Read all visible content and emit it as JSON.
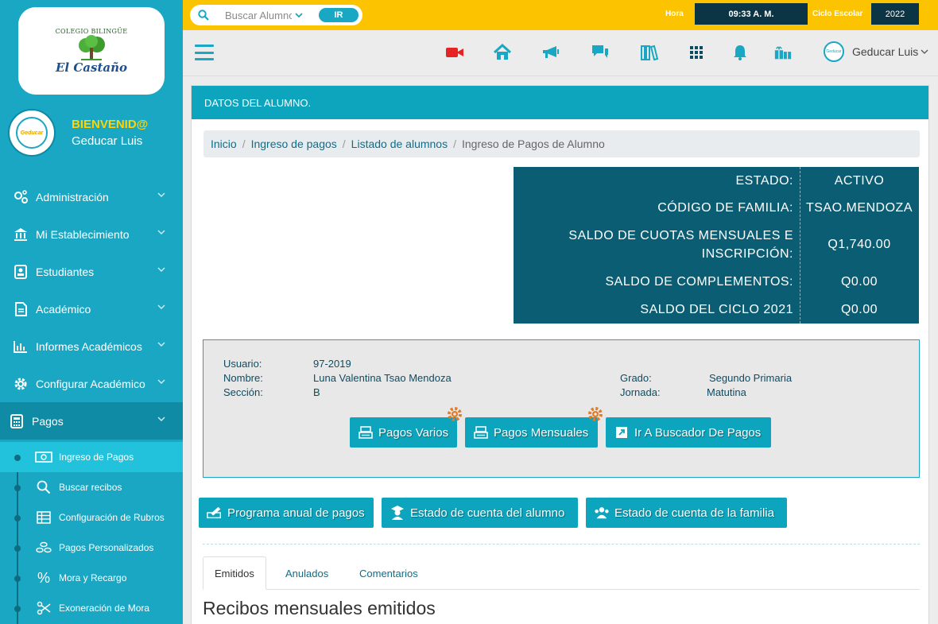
{
  "school": {
    "logo_arc": "COLEGIO BILINGÜE",
    "logo_name": "El Castaño",
    "avatar_text": "Geducar"
  },
  "welcome": {
    "greeting": "BIENVENID@",
    "user": "Geducar Luis"
  },
  "menu": [
    {
      "label": "Administración",
      "icon": "gears-icon"
    },
    {
      "label": "Mi Establecimiento",
      "icon": "bank-icon"
    },
    {
      "label": "Estudiantes",
      "icon": "student-card-icon"
    },
    {
      "label": "Académico",
      "icon": "document-icon"
    },
    {
      "label": "Informes Académicos",
      "icon": "bar-chart-icon"
    },
    {
      "label": "Configurar Académico",
      "icon": "gear-icon"
    },
    {
      "label": "Pagos",
      "icon": "calculator-icon"
    }
  ],
  "submenu": [
    {
      "label": "Ingreso de Pagos",
      "icon": "money-icon"
    },
    {
      "label": "Buscar recibos",
      "icon": "search-icon"
    },
    {
      "label": "Configuración de Rubros",
      "icon": "table-icon"
    },
    {
      "label": "Pagos Personalizados",
      "icon": "coins-icon"
    },
    {
      "label": "Mora y Recargo",
      "icon": "percent-icon"
    },
    {
      "label": "Exoneración de Mora",
      "icon": "scissors-icon"
    }
  ],
  "topbar": {
    "search_placeholder": "Buscar Alumno",
    "search_button": "IR",
    "hora_label": "Hora",
    "hora_value": "09:33 A. M.",
    "ciclo_label": "Ciclo Escolar",
    "ciclo_value": "2022"
  },
  "user_menu": {
    "name": "Geducar Luis",
    "avatar_text": "Geducar"
  },
  "card": {
    "header": "DATOS DEL ALUMNO."
  },
  "breadcrumb": {
    "items": [
      "Inicio",
      "Ingreso de pagos",
      "Listado de alumnos"
    ],
    "current": "Ingreso de Pagos de Alumno"
  },
  "status": {
    "rows": [
      {
        "key": "ESTADO:",
        "value": "ACTIVO"
      },
      {
        "key": "CÓDIGO DE FAMILIA:",
        "value": "TSAO.MENDOZA"
      },
      {
        "key": "SALDO DE CUOTAS MENSUALES E",
        "key2": "INSCRIPCIÓN:",
        "value": "Q1,740.00"
      },
      {
        "key": "SALDO DE COMPLEMENTOS:",
        "value": "Q0.00"
      },
      {
        "key": "SALDO DEL CICLO 2021",
        "value": "Q0.00"
      }
    ]
  },
  "student": {
    "usuario_label": "Usuario:",
    "usuario": "97-2019",
    "nombre_label": "Nombre:",
    "nombre": "Luna Valentina Tsao Mendoza",
    "seccion_label": "Sección:",
    "seccion": "B",
    "grado_label": "Grado:",
    "grado": "Segundo Primaria",
    "jornada_label": "Jornada:",
    "jornada": "Matutina"
  },
  "actions": {
    "pagos_varios": "Pagos Varios",
    "pagos_mensuales": "Pagos Mensuales",
    "buscador": "Ir A Buscador De Pagos",
    "programa": "Programa anual de pagos",
    "estado_alumno": "Estado de cuenta del alumno",
    "estado_familia": "Estado de cuenta de la familia"
  },
  "tabs": [
    "Emitidos",
    "Anulados",
    "Comentarios"
  ],
  "section_title": "Recibos mensuales emitidos",
  "colors": {
    "primary": "#1aa7c3",
    "topbar": "#fcc300",
    "dark": "#0b5d73",
    "gear": "#e07b2a"
  }
}
